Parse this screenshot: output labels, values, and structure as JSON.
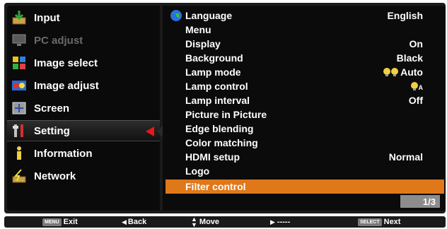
{
  "left_menu": {
    "items": [
      {
        "label": "Input",
        "icon": "input-icon"
      },
      {
        "label": "PC adjust",
        "icon": "pc-adjust-icon"
      },
      {
        "label": "Image select",
        "icon": "image-select-icon"
      },
      {
        "label": "Image adjust",
        "icon": "image-adjust-icon"
      },
      {
        "label": "Screen",
        "icon": "screen-icon"
      },
      {
        "label": "Setting",
        "icon": "setting-icon"
      },
      {
        "label": "Information",
        "icon": "information-icon"
      },
      {
        "label": "Network",
        "icon": "network-icon"
      }
    ],
    "selected_index": 5
  },
  "settings": {
    "rows": [
      {
        "name": "Language",
        "value": "English"
      },
      {
        "name": "Menu",
        "value": ""
      },
      {
        "name": "Display",
        "value": "On"
      },
      {
        "name": "Background",
        "value": "Black"
      },
      {
        "name": "Lamp mode",
        "value": "Auto"
      },
      {
        "name": "Lamp control",
        "value": ""
      },
      {
        "name": "Lamp interval",
        "value": "Off"
      },
      {
        "name": "Picture in Picture",
        "value": ""
      },
      {
        "name": "Edge blending",
        "value": ""
      },
      {
        "name": "Color matching",
        "value": ""
      },
      {
        "name": "HDMI setup",
        "value": "Normal"
      },
      {
        "name": "Logo",
        "value": ""
      },
      {
        "name": "Filter control",
        "value": ""
      }
    ],
    "highlight_index": 12,
    "lamp_control_sub": "A",
    "page": "1/3"
  },
  "bottom_bar": {
    "menu_key": "MENU",
    "exit": "Exit",
    "back": "Back",
    "move": "Move",
    "right_action": "-----",
    "select_key": "SELECT",
    "next": "Next"
  },
  "colors": {
    "highlight": "#e0781a",
    "selected_arrow": "#e8181b",
    "page_box": "#8c8c8c"
  }
}
